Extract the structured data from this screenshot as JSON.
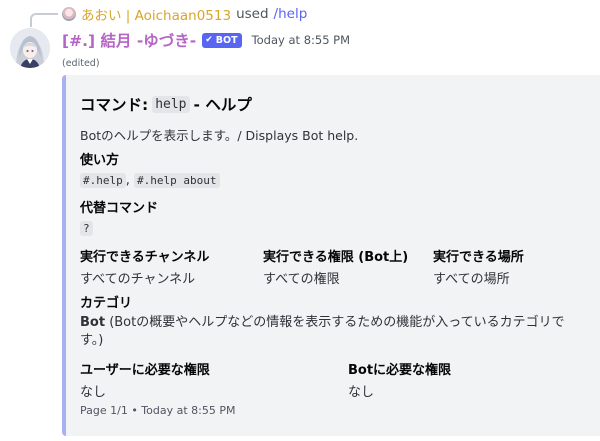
{
  "reply": {
    "user": "あおい | Aoichaan0513",
    "used": "used",
    "command": "/help"
  },
  "message": {
    "author": "[#.] 結月 -ゆづき-",
    "badge": "BOT",
    "timestamp": "Today at 8:55 PM",
    "edited": "(edited)"
  },
  "embed": {
    "title_prefix": "コマンド:",
    "title_code": "help",
    "title_suffix": "- ヘルプ",
    "description": "Botのヘルプを表示します。/ Displays Bot help.",
    "usage_name": "使い方",
    "usage_code_1": "#.help",
    "usage_sep": ",",
    "usage_code_2": "#.help about",
    "alias_name": "代替コマンド",
    "alias_code": "?",
    "channel_name": "実行できるチャンネル",
    "channel_value": "すべてのチャンネル",
    "perm_name": "実行できる権限 (Bot上)",
    "perm_value": "すべての権限",
    "place_name": "実行できる場所",
    "place_value": "すべての場所",
    "category_name": "カテゴリ",
    "category_bold": "Bot",
    "category_text": " (Botの概要やヘルプなどの情報を表示するための機能が入っているカテゴリです。)",
    "user_perm_name": "ユーザーに必要な権限",
    "user_perm_value": "なし",
    "bot_perm_name": "Botに必要な権限",
    "bot_perm_value": "なし",
    "footer": "Page 1/1 • Today at 8:55 PM"
  },
  "colors": {
    "embed_bar": "#a8b0f0",
    "embed_bg": "#f2f3f5",
    "bot_name": "#b565c4",
    "reply_user": "#d9a52b",
    "link": "#5865f2",
    "badge": "#5865f2"
  }
}
